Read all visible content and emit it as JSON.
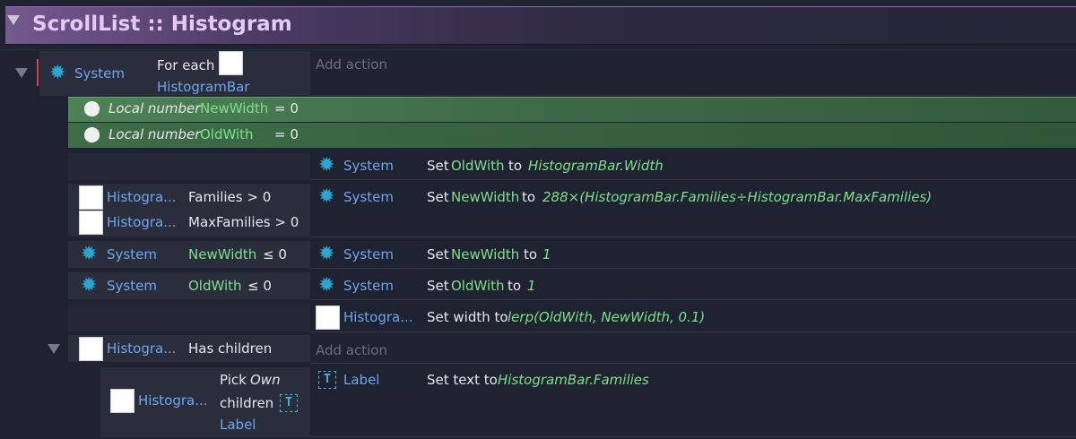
{
  "group": {
    "title": "ScrollList :: Histogram"
  },
  "add_action": "Add action",
  "event1": {
    "object": "System",
    "condition": "For each",
    "condition_object": "HistogramBar"
  },
  "locals": [
    {
      "keyword": "Local number",
      "name": "NewWidth",
      "value": "= 0"
    },
    {
      "keyword": "Local number",
      "name": "OldWith",
      "value": "= 0"
    }
  ],
  "sub1": {
    "action_object": "System",
    "action_prefix": "Set",
    "action_var": "OldWith",
    "action_to": "to",
    "action_expr": "HistogramBar.Width"
  },
  "sub2": {
    "cond1_object": "Histogra...",
    "cond1_text": "Families > 0",
    "cond2_object": "Histogra...",
    "cond2_text": "MaxFamilies > 0",
    "action_object": "System",
    "action_prefix": "Set",
    "action_var": "NewWidth",
    "action_to": "to",
    "action_expr": "288×(HistogramBar.Families÷HistogramBar.MaxFamilies)"
  },
  "sub3": {
    "cond_object": "System",
    "cond_var": "NewWidth",
    "cond_op": "≤ 0",
    "action_object": "System",
    "action_prefix": "Set",
    "action_var": "NewWidth",
    "action_to": "to",
    "action_expr": "1"
  },
  "sub4": {
    "cond_object": "System",
    "cond_var": "OldWith",
    "cond_op": "≤ 0",
    "action_object": "System",
    "action_prefix": "Set",
    "action_var": "OldWith",
    "action_to": "to",
    "action_expr": "1"
  },
  "sub5": {
    "action_object": "Histogra...",
    "action_text": "Set width to",
    "action_expr": "lerp(OldWith, NewWidth, 0.1)"
  },
  "sub6": {
    "cond_object": "Histogra...",
    "cond_text": "Has children"
  },
  "sub7": {
    "cond_object": "Histogra...",
    "cond_pick": "Pick",
    "cond_own": "Own",
    "cond_children": "children",
    "cond_label": "Label",
    "action_object": "Label",
    "action_text": "Set text to",
    "action_expr": "HistogramBar.Families"
  },
  "icons": {
    "system": "gear-icon",
    "local": "pin-icon",
    "text": "text-object-icon",
    "collapse": "triangle-down-icon"
  },
  "colors": {
    "group_title": "#e4c8f5",
    "object": "#6fa6ee",
    "variable": "#7ee08a",
    "gear": "#2aa6d0",
    "selected": "#d6434f"
  }
}
